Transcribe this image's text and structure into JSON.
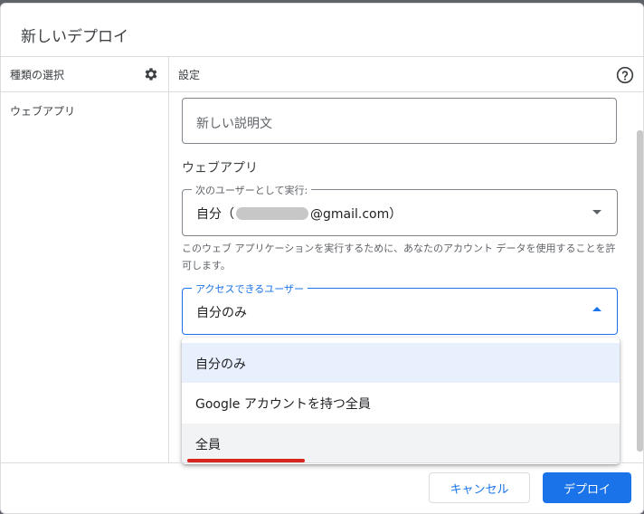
{
  "dialog": {
    "title": "新しいデプロイ"
  },
  "left_panel": {
    "header": "種類の選択",
    "items": [
      {
        "label": "ウェブアプリ"
      }
    ]
  },
  "right_panel": {
    "header": "設定",
    "description_placeholder": "新しい説明文",
    "section_label": "ウェブアプリ",
    "execute_as": {
      "label": "次のユーザーとして実行:",
      "value_prefix": "自分（",
      "value_suffix": "@gmail.com）"
    },
    "help_text": "このウェブ アプリケーションを実行するために、あなたのアカウント データを使用することを許可します。",
    "access": {
      "label": "アクセスできるユーザー",
      "value": "自分のみ",
      "options": [
        {
          "label": "自分のみ",
          "selected": true
        },
        {
          "label": "Google アカウントを持つ全員",
          "selected": false
        },
        {
          "label": "全員",
          "selected": false
        }
      ]
    }
  },
  "footer": {
    "cancel_label": "キャンセル",
    "deploy_label": "デプロイ"
  },
  "colors": {
    "accent": "#1a73e8",
    "annotation_underline": "#d7261e",
    "selected_option_bg": "#e8f0fe"
  },
  "icons": {
    "left_header": "gear-icon",
    "right_header": "help-circle-icon"
  }
}
